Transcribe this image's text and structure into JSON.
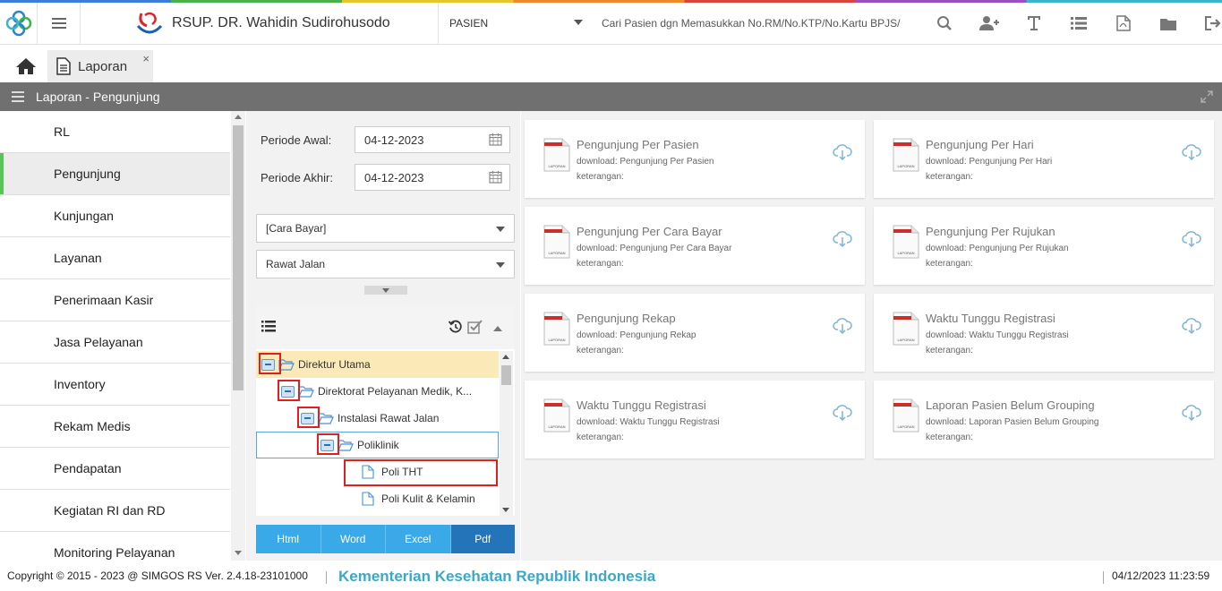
{
  "header": {
    "hospital_name": "RSUP. DR. Wahidin Sudirohusodo",
    "mode": "PASIEN",
    "search_placeholder": "Cari Pasien dgn Memasukkan No.RM/No.KTP/No.Kartu BPJS/",
    "icons": [
      "search-icon",
      "add-user-icon",
      "text-icon",
      "list-icon",
      "pdf-icon",
      "folder-icon",
      "logout-icon"
    ]
  },
  "tabs": [
    {
      "label": "Laporan",
      "close": "×"
    }
  ],
  "titlebar": {
    "title": "Laporan - Pengunjung"
  },
  "sidebar": {
    "items": [
      {
        "label": "RL"
      },
      {
        "label": "Pengunjung",
        "active": true
      },
      {
        "label": "Kunjungan"
      },
      {
        "label": "Layanan"
      },
      {
        "label": "Penerimaan Kasir"
      },
      {
        "label": "Jasa Pelayanan"
      },
      {
        "label": "Inventory"
      },
      {
        "label": "Rekam Medis"
      },
      {
        "label": "Pendapatan"
      },
      {
        "label": "Kegiatan RI dan RD"
      },
      {
        "label": "Monitoring Pelayanan"
      }
    ]
  },
  "filters": {
    "periode_awal_label": "Periode Awal:",
    "periode_awal_value": "04-12-2023",
    "periode_akhir_label": "Periode Akhir:",
    "periode_akhir_value": "04-12-2023",
    "cara_bayar": "[Cara Bayar]",
    "jenis": "Rawat Jalan",
    "tree": [
      {
        "label": "Direktur Utama",
        "level": 0,
        "type": "folder"
      },
      {
        "label": "Direktorat Pelayanan Medik, K...",
        "level": 1,
        "type": "folder"
      },
      {
        "label": "Instalasi Rawat Jalan",
        "level": 2,
        "type": "folder"
      },
      {
        "label": "Poliklinik",
        "level": 3,
        "type": "folder"
      },
      {
        "label": "Poli THT",
        "level": 4,
        "type": "file"
      },
      {
        "label": "Poli Kulit & Kelamin",
        "level": 4,
        "type": "file"
      }
    ],
    "formats": [
      "Html",
      "Word",
      "Excel",
      "Pdf"
    ],
    "active_format": "Pdf"
  },
  "reports": [
    {
      "title": "Pengunjung Per Pasien",
      "download": "download: Pengunjung Per Pasien",
      "note": "keterangan:"
    },
    {
      "title": "Pengunjung Per Hari",
      "download": "download: Pengunjung Per Hari",
      "note": "keterangan:"
    },
    {
      "title": "Pengunjung Per Cara Bayar",
      "download": "download: Pengunjung Per Cara Bayar",
      "note": "keterangan:"
    },
    {
      "title": "Pengunjung Per Rujukan",
      "download": "download: Pengunjung Per Rujukan",
      "note": "keterangan:"
    },
    {
      "title": "Pengunjung Rekap",
      "download": "download: Pengunjung Rekap",
      "note": "keterangan:"
    },
    {
      "title": "Waktu Tunggu Registrasi",
      "download": "download: Waktu Tunggu Registrasi",
      "note": "keterangan:"
    },
    {
      "title": "Waktu Tunggu Registrasi",
      "download": "download: Waktu Tunggu Registrasi",
      "note": "keterangan:"
    },
    {
      "title": "Laporan Pasien Belum Grouping",
      "download": "download: Laporan Pasien Belum Grouping",
      "note": "keterangan:"
    }
  ],
  "doc_icon_label": "LAPORAN",
  "footer": {
    "copyright": "Copyright © 2015 - 2023 @ SIMGOS RS Ver. 2.4.18-23101000",
    "ministry": "Kementerian Kesehatan Republik Indonesia",
    "datetime": "04/12/2023 11:23:59"
  },
  "colors": {
    "titlebar": "#707070",
    "active_nav_accent": "#5ac35a",
    "format_button": "#39a9e8",
    "format_button_active": "#2374b8",
    "tree_highlight": "#fbe9b7",
    "annotation_red": "#e0201e",
    "ministry_text": "#3aa8c9"
  }
}
